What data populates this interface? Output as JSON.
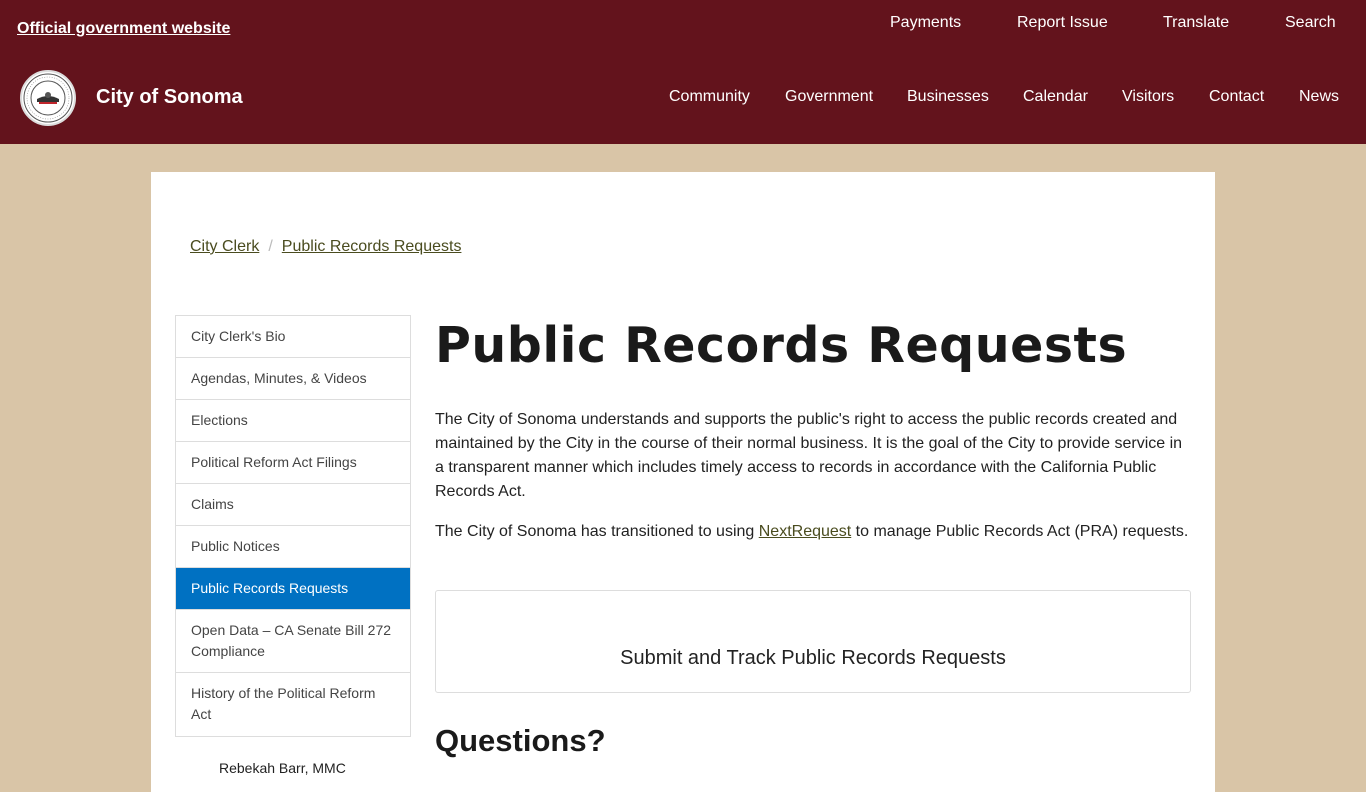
{
  "header": {
    "official_label": "Official government website",
    "site_name": "City of Sonoma",
    "utility_nav": [
      "Payments",
      "Report Issue",
      "Translate",
      "Search"
    ],
    "main_nav": [
      "Community",
      "Government",
      "Businesses",
      "Calendar",
      "Visitors",
      "Contact",
      "News"
    ]
  },
  "breadcrumb": [
    "City Clerk",
    "Public Records Requests"
  ],
  "sidebar": {
    "items": [
      "City Clerk's Bio",
      "Agendas, Minutes, & Videos",
      "Elections",
      "Political Reform Act Filings",
      "Claims",
      "Public Notices",
      "Public Records Requests",
      "Open Data – CA Senate Bill 272 Compliance",
      "History of the Political Reform Act"
    ],
    "active_index": 6,
    "below_text": "Rebekah Barr, MMC"
  },
  "main": {
    "title": "Public Records Requests",
    "paragraph1": "The City of Sonoma understands and supports the public's right to access the public records created and maintained by the City in the course of their normal business. It is the goal of the City to provide service in a transparent manner which includes timely access to records in accordance with the California Public Records Act.",
    "paragraph2_before": "The City of Sonoma has transitioned to using ",
    "paragraph2_link": "NextRequest",
    "paragraph2_after": " to manage Public Records Act (PRA) requests.",
    "cta_label": "Submit and Track Public Records Requests",
    "questions_heading": "Questions?"
  },
  "colors": {
    "header_bg": "#63131c",
    "page_bg": "#d9c5a7",
    "active_nav": "#0071c2",
    "link": "#4a4c1f"
  }
}
